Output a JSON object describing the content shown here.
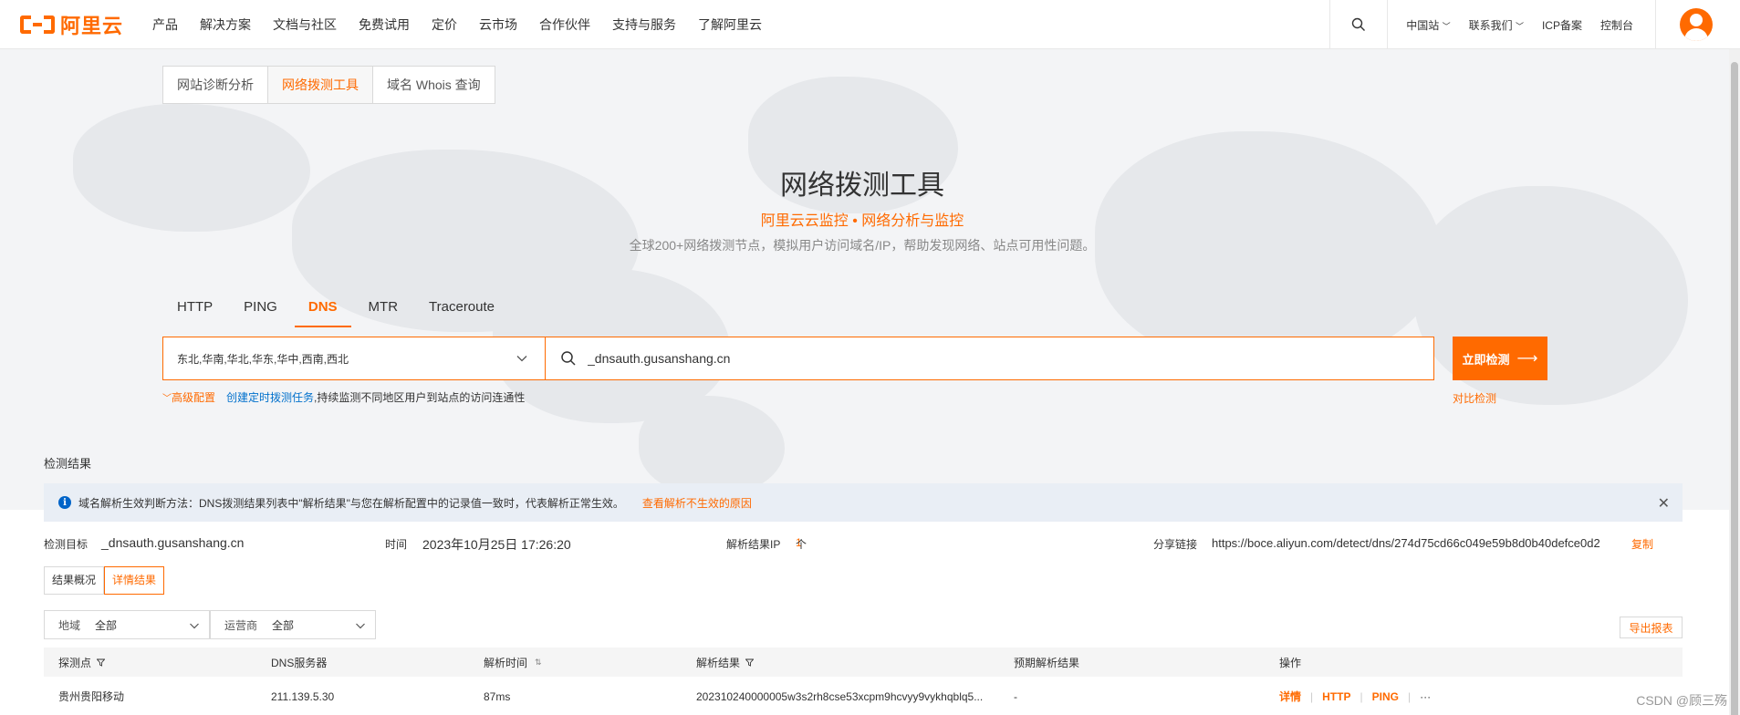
{
  "nav": {
    "logo_text": "阿里云",
    "items": [
      "产品",
      "解决方案",
      "文档与社区",
      "免费试用",
      "定价",
      "云市场",
      "合作伙伴",
      "支持与服务",
      "了解阿里云"
    ],
    "right": {
      "region": "中国站",
      "contact": "联系我们",
      "icp": "ICP备案",
      "console": "控制台"
    }
  },
  "tool_tabs": [
    {
      "label": "网站诊断分析",
      "active": false
    },
    {
      "label": "网络拨测工具",
      "active": true
    },
    {
      "label": "域名 Whois 查询",
      "active": false
    }
  ],
  "hero": {
    "title": "网络拨测工具",
    "subtitle": "阿里云云监控 • 网络分析与监控",
    "description": "全球200+网络拨测节点，模拟用户访问域名/IP，帮助发现网络、站点可用性问题。"
  },
  "protocol_tabs": [
    {
      "label": "HTTP",
      "active": false
    },
    {
      "label": "PING",
      "active": false
    },
    {
      "label": "DNS",
      "active": true
    },
    {
      "label": "MTR",
      "active": false
    },
    {
      "label": "Traceroute",
      "active": false
    }
  ],
  "search": {
    "regions": "东北,华南,华北,华东,华中,西南,西北",
    "domain_value": "_dnsauth.gusanshang.cn",
    "detect_button": "立即检测",
    "advanced": "高级配置",
    "create_task_link": "创建定时拨测任务",
    "create_task_rest": ",持续监测不同地区用户到站点的访问连通性",
    "compare": "对比检测"
  },
  "results": {
    "title": "检测结果",
    "notice": "域名解析生效判断方法：DNS拨测结果列表中\"解析结果\"与您在解析配置中的记录值一致时，代表解析正常生效。",
    "notice_link": "查看解析不生效的原因",
    "target_label": "检测目标",
    "target_value": "_dnsauth.gusanshang.cn",
    "time_label": "时间",
    "time_value": "2023年10月25日 17:26:20",
    "ip_label": "解析结果IP",
    "ip_count": "1",
    "ip_unit": "个",
    "share_label": "分享链接",
    "share_value": "https://boce.aliyun.com/detect/dns/274d75cd66c049e59b8d0b40defce0d2",
    "copy": "复制",
    "view_tabs": [
      {
        "label": "结果概况",
        "active": false
      },
      {
        "label": "详情结果",
        "active": true
      }
    ],
    "filters": [
      {
        "label": "地域",
        "value": "全部"
      },
      {
        "label": "运营商",
        "value": "全部"
      }
    ],
    "export": "导出报表",
    "columns": [
      "探测点",
      "DNS服务器",
      "解析时间",
      "解析结果",
      "预期解析结果",
      "操作"
    ],
    "rows": [
      {
        "probe": "贵州贵阳移动",
        "dns_server": "211.139.5.30",
        "resolve_time": "87ms",
        "result": "202310240000005w3s2rh8cse53xcpm9hcvyy9vykhqblq5...",
        "expected": "-",
        "actions": [
          "详情",
          "HTTP",
          "PING",
          "···"
        ]
      }
    ]
  },
  "watermark": "CSDN @顾三殇",
  "colors": {
    "accent": "#ff6a00",
    "link": "#0070cc",
    "info": "#0064c8"
  }
}
